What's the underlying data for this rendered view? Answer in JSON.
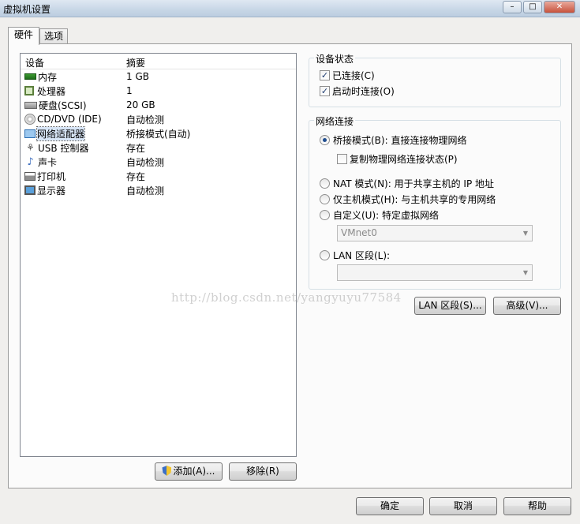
{
  "window": {
    "title": "虚拟机设置"
  },
  "tabs": [
    {
      "label": "硬件"
    },
    {
      "label": "选项"
    }
  ],
  "device_list": {
    "headers": {
      "device": "设备",
      "summary": "摘要"
    },
    "rows": [
      {
        "icon": "memory-icon",
        "device": "内存",
        "summary": "1 GB"
      },
      {
        "icon": "processor-icon",
        "device": "处理器",
        "summary": "1"
      },
      {
        "icon": "hard-disk-icon",
        "device": "硬盘(SCSI)",
        "summary": "20 GB"
      },
      {
        "icon": "cd-dvd-icon",
        "device": "CD/DVD (IDE)",
        "summary": "自动检测"
      },
      {
        "icon": "network-adapter-icon",
        "device": "网络适配器",
        "summary": "桥接模式(自动)"
      },
      {
        "icon": "usb-icon",
        "device": "USB 控制器",
        "summary": "存在"
      },
      {
        "icon": "sound-card-icon",
        "device": "声卡",
        "summary": "自动检测"
      },
      {
        "icon": "printer-icon",
        "device": "打印机",
        "summary": "存在"
      },
      {
        "icon": "display-icon",
        "device": "显示器",
        "summary": "自动检测"
      }
    ]
  },
  "left_buttons": {
    "add": "添加(A)...",
    "remove": "移除(R)"
  },
  "device_status": {
    "title": "设备状态",
    "connected": "已连接(C)",
    "connect_at_power_on": "启动时连接(O)"
  },
  "network": {
    "title": "网络连接",
    "bridged": "桥接模式(B): 直接连接物理网络",
    "replicate": "复制物理网络连接状态(P)",
    "nat": "NAT 模式(N): 用于共享主机的 IP 地址",
    "host_only": "仅主机模式(H): 与主机共享的专用网络",
    "custom": "自定义(U): 特定虚拟网络",
    "custom_select": "VMnet0",
    "lan_segment": "LAN 区段(L):",
    "lan_select": ""
  },
  "network_buttons": {
    "lan_segments": "LAN 区段(S)...",
    "advanced": "高级(V)..."
  },
  "footer": {
    "ok": "确定",
    "cancel": "取消",
    "help": "帮助"
  },
  "watermark": "http://blog.csdn.net/yangyuyu77584"
}
